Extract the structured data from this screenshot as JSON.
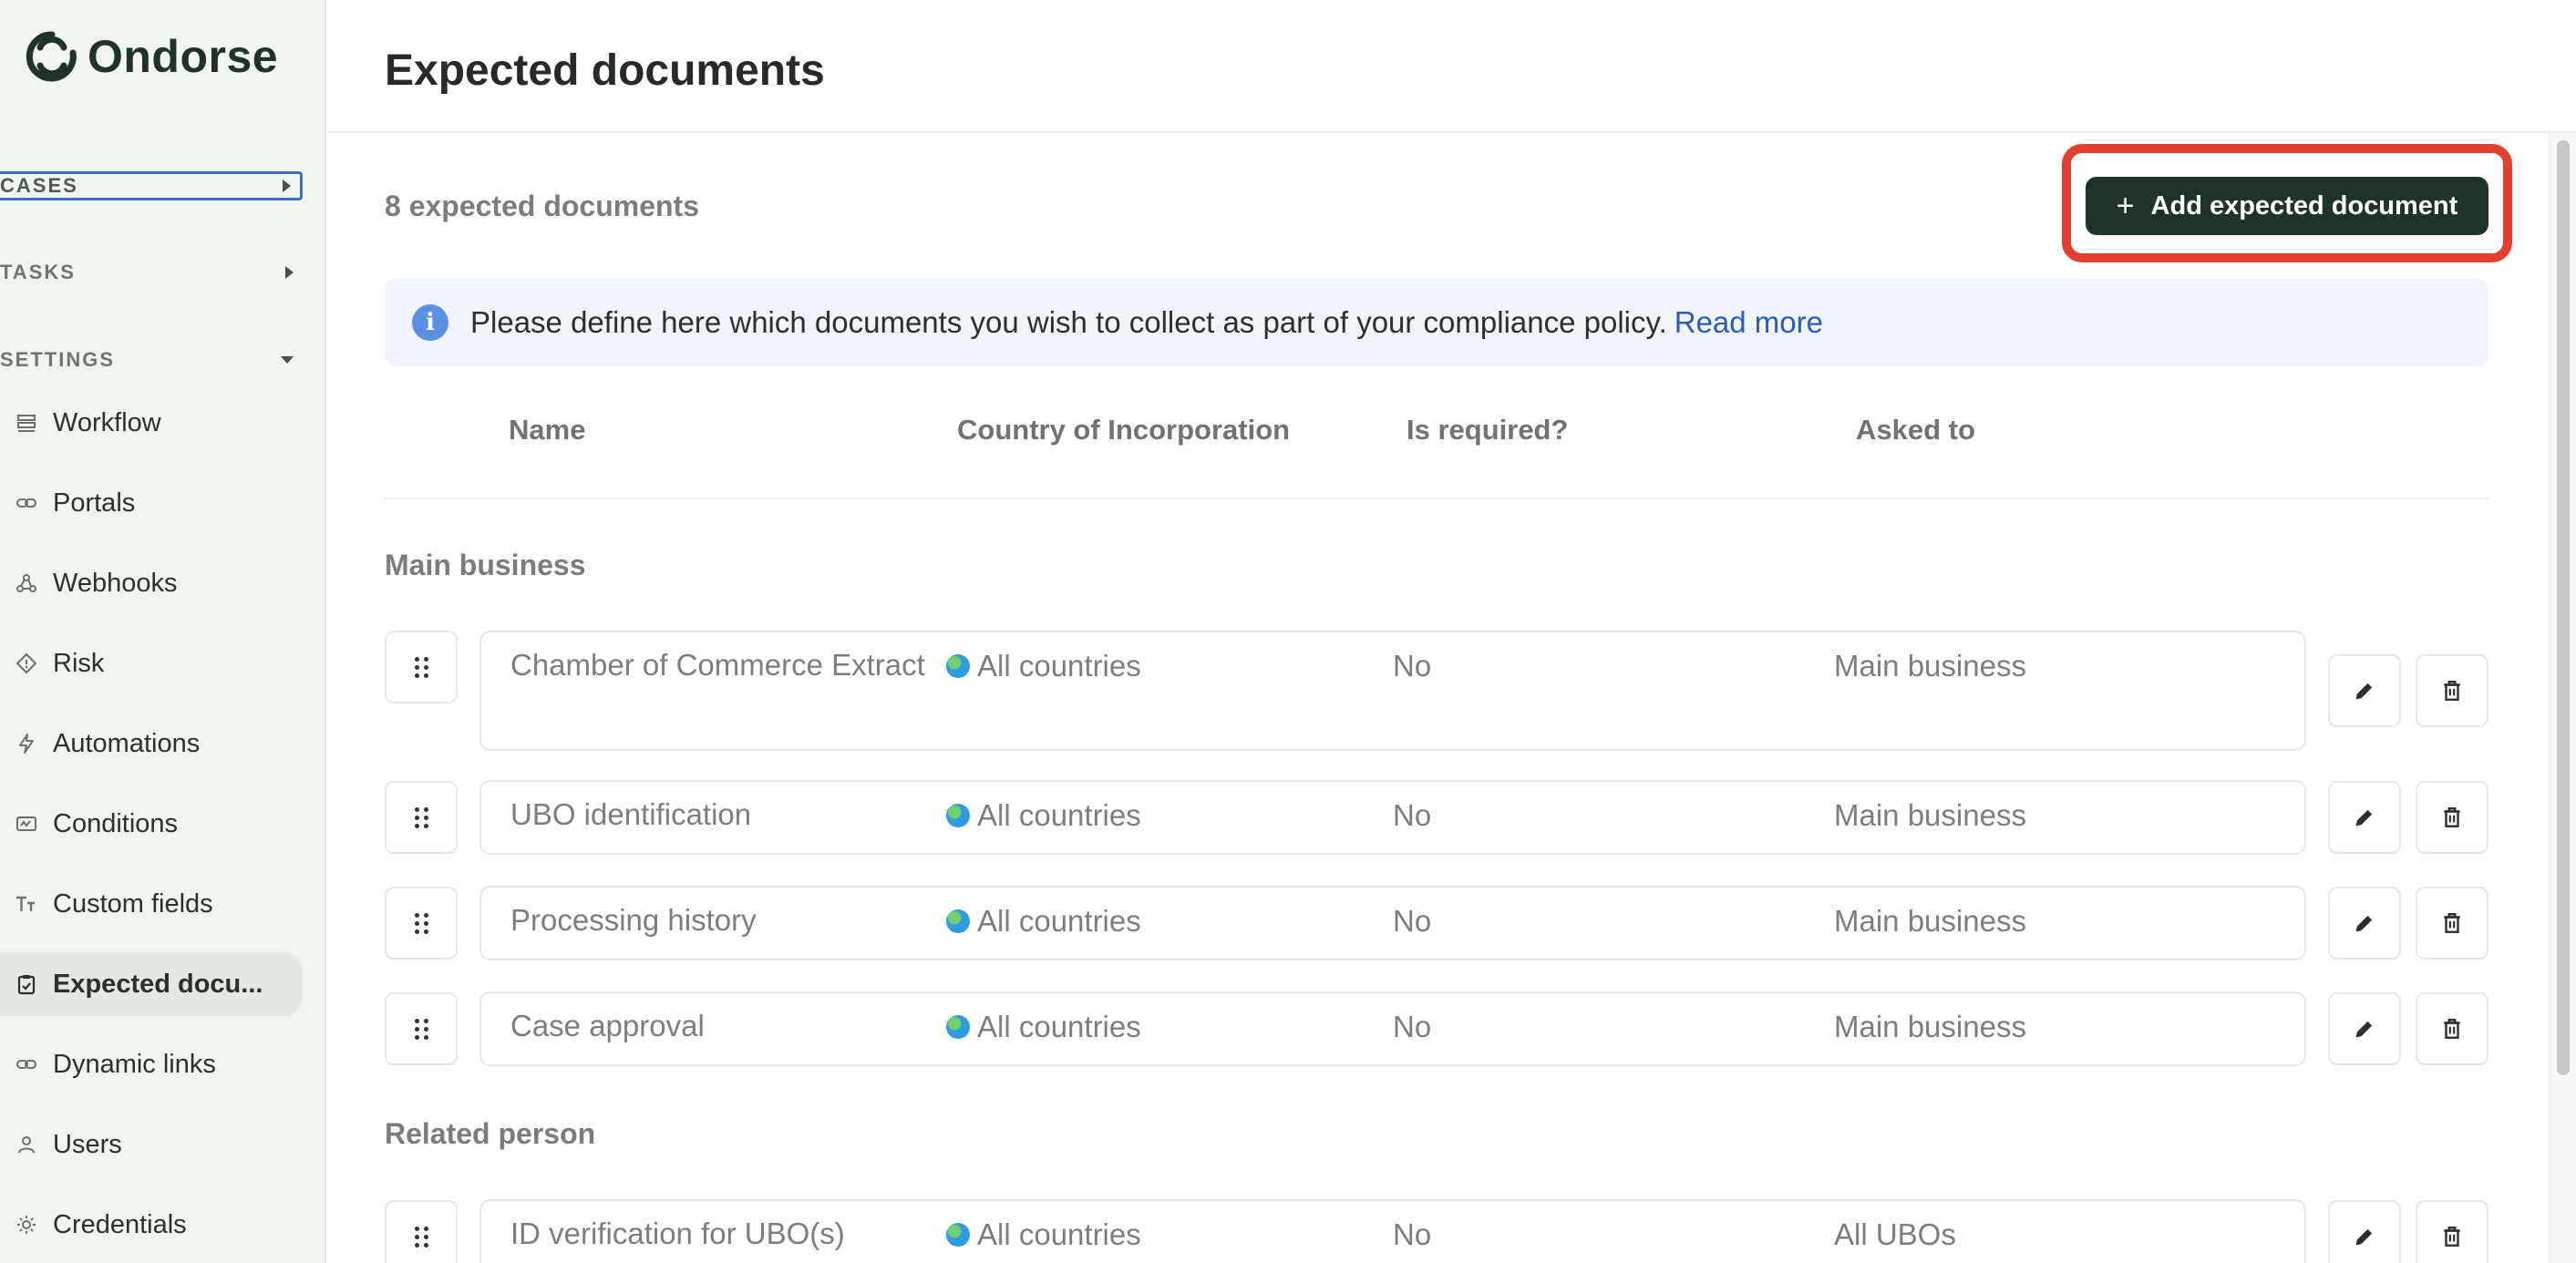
{
  "brand": {
    "name": "Ondorse"
  },
  "sidebar": {
    "sections": {
      "cases": "CASES",
      "tasks": "TASKS",
      "settings": "SETTINGS"
    },
    "items": [
      {
        "label": "Workflow",
        "icon": "workflow-icon"
      },
      {
        "label": "Portals",
        "icon": "link-icon"
      },
      {
        "label": "Webhooks",
        "icon": "webhook-icon"
      },
      {
        "label": "Risk",
        "icon": "risk-diamond-icon"
      },
      {
        "label": "Automations",
        "icon": "lightning-icon"
      },
      {
        "label": "Conditions",
        "icon": "conditions-icon"
      },
      {
        "label": "Custom fields",
        "icon": "text-type-icon"
      },
      {
        "label": "Expected docu...",
        "icon": "clipboard-check-icon",
        "active": true
      },
      {
        "label": "Dynamic links",
        "icon": "link-icon"
      },
      {
        "label": "Users",
        "icon": "user-icon"
      },
      {
        "label": "Credentials",
        "icon": "gear-icon"
      }
    ]
  },
  "page": {
    "title": "Expected documents",
    "count": "8 expected documents",
    "add_button": "Add expected document",
    "info_text": "Please define here which documents you wish to collect as part of your compliance policy.",
    "info_link": "Read more"
  },
  "table": {
    "headers": {
      "name": "Name",
      "country": "Country of Incorporation",
      "required": "Is required?",
      "asked": "Asked to"
    },
    "groups": [
      {
        "title": "Main business",
        "rows": [
          {
            "name": "Chamber of Commerce Extract",
            "country": "All countries",
            "required": "No",
            "asked": "Main business"
          },
          {
            "name": "UBO identification",
            "country": "All countries",
            "required": "No",
            "asked": "Main business"
          },
          {
            "name": "Processing history",
            "country": "All countries",
            "required": "No",
            "asked": "Main business"
          },
          {
            "name": "Case approval",
            "country": "All countries",
            "required": "No",
            "asked": "Main business"
          }
        ]
      },
      {
        "title": "Related person",
        "rows": [
          {
            "name": "ID verification for UBO(s)",
            "country": "All countries",
            "required": "No",
            "asked": "All UBOs"
          }
        ]
      }
    ]
  },
  "colors": {
    "brand_dark": "#1f3328",
    "highlight": "#e2402f",
    "link": "#2c5db5",
    "sidebar_bg": "#f1f5ef"
  }
}
